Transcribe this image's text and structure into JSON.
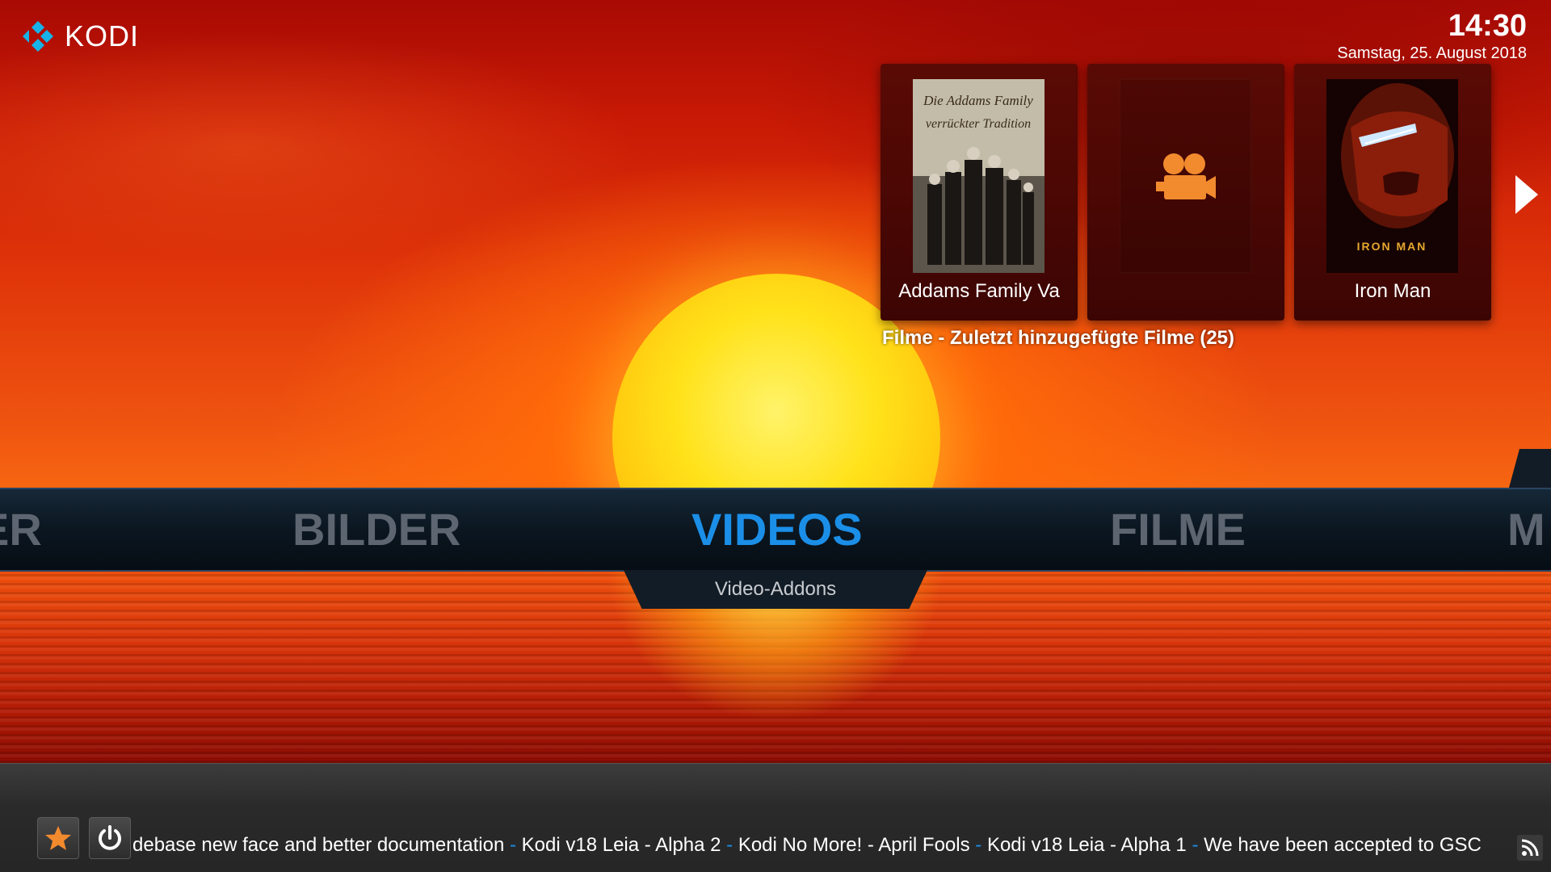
{
  "app": {
    "logo_text": "KODI"
  },
  "header": {
    "time": "14:30",
    "date": "Samstag, 25. August 2018"
  },
  "widget": {
    "title": "Filme - Zuletzt hinzugefügte Filme (25)",
    "items": [
      {
        "label": "Addams Family Va",
        "poster_title_line1": "Die Addams Family",
        "poster_title_line2": "verrückter Tradition"
      },
      {
        "label": ""
      },
      {
        "label": "Iron Man",
        "poster_title": "IRON MAN"
      }
    ]
  },
  "menu": {
    "items": [
      "ER",
      "BILDER",
      "VIDEOS",
      "FILME",
      "M"
    ],
    "selected": "VIDEOS",
    "submenu": "Video-Addons"
  },
  "ticker": {
    "items": [
      "debase new face and better documentation",
      "Kodi v18 Leia - Alpha 2",
      "Kodi No More! - April Fools",
      "Kodi v18 Leia - Alpha 1",
      "We have been accepted to GSC"
    ],
    "separator": " - "
  },
  "colors": {
    "accent": "#1b8fe8",
    "menu_inactive": "#5d6670",
    "icon_orange": "#f28a2e"
  },
  "icons": [
    "kodi-logo-icon",
    "movie-camera-icon",
    "chevron-right-icon",
    "star-icon",
    "power-icon",
    "rss-icon"
  ]
}
